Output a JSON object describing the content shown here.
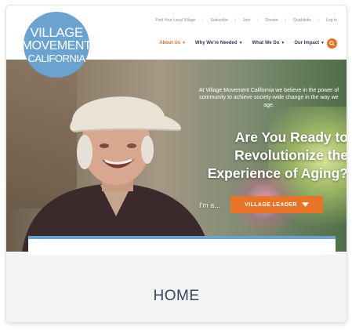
{
  "logo": {
    "line1": "VILLAGE",
    "line2": "MOVEMENT",
    "line3": "CALIFORNIA"
  },
  "utility_nav": [
    "Find Your Local Village",
    "Subscribe",
    "Join",
    "Donate",
    "Quicklinks",
    "Log In"
  ],
  "main_nav": [
    {
      "label": "About Us",
      "active": true
    },
    {
      "label": "Why We're Needed",
      "active": false
    },
    {
      "label": "What We Do",
      "active": false
    },
    {
      "label": "Our Impact",
      "active": false
    }
  ],
  "hero": {
    "subtext": "At Village Movement California we believe in the power of community to achieve society-wide change in the way we age.",
    "title": "Are You Ready to Revolutionize the Experience of Aging?",
    "prompt": "I'm a...",
    "selector_value": "VILLAGE LEADER"
  },
  "page_heading": "HOME",
  "colors": {
    "accent": "#e86f24",
    "brand_blue": "#6aa3cf",
    "nav_text": "#2b3a57",
    "heading": "#34455e"
  },
  "icons": {
    "search": "search-icon",
    "dropdown": "caret-down-icon"
  }
}
